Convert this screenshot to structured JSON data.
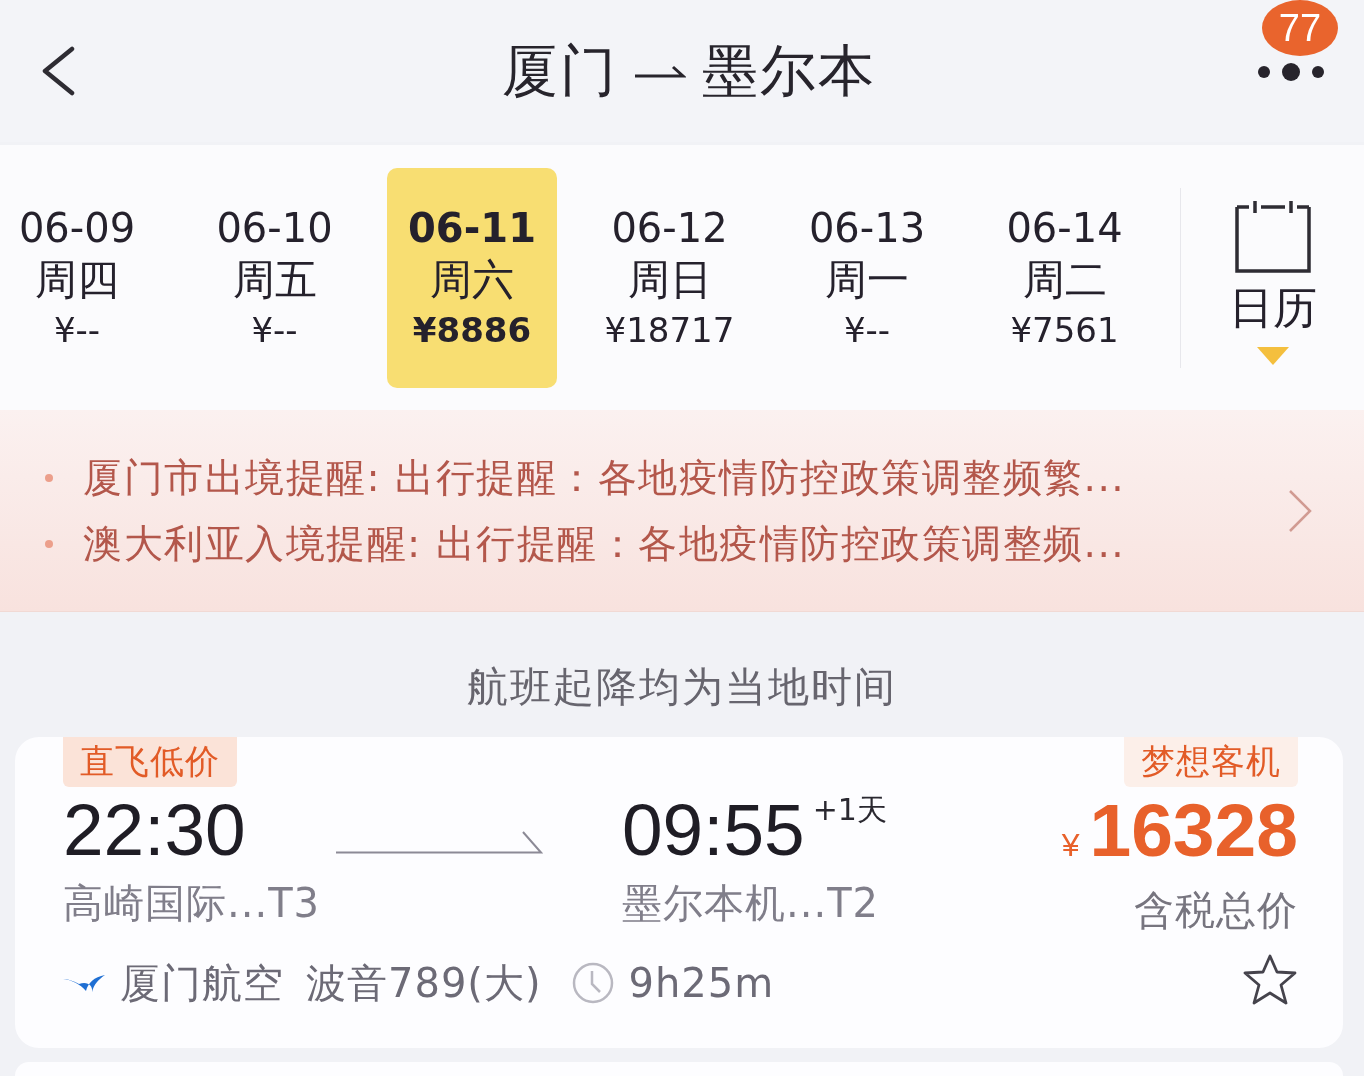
{
  "header": {
    "origin": "厦门",
    "destination": "墨尔本",
    "badge": "77"
  },
  "dates": [
    {
      "date": "06-09",
      "weekday": "周四",
      "price": "¥--",
      "selected": false
    },
    {
      "date": "06-10",
      "weekday": "周五",
      "price": "¥--",
      "selected": false
    },
    {
      "date": "06-11",
      "weekday": "周六",
      "price": "¥8886",
      "selected": true
    },
    {
      "date": "06-12",
      "weekday": "周日",
      "price": "¥18717",
      "selected": false
    },
    {
      "date": "06-13",
      "weekday": "周一",
      "price": "¥--",
      "selected": false
    },
    {
      "date": "06-14",
      "weekday": "周二",
      "price": "¥7561",
      "selected": false
    }
  ],
  "calendar": {
    "label": "日历"
  },
  "notices": [
    "厦门市出境提醒: 出行提醒：各地疫情防控政策调整频繁...",
    "澳大利亚入境提醒: 出行提醒：各地疫情防控政策调整频..."
  ],
  "note": "航班起降均为当地时间",
  "flights": [
    {
      "tag": "直飞低价",
      "aircraft_tag": "梦想客机",
      "departure": {
        "time": "22:30",
        "airport": "高崎国际...T3"
      },
      "arrival": {
        "time": "09:55",
        "day_offset": "+1天",
        "airport": "墨尔本机...T2"
      },
      "currency": "¥",
      "price": "16328",
      "price_note": "含税总价",
      "airline": "厦门航空",
      "aircraft": "波音789(大)",
      "duration": "9h25m",
      "favorited": false
    }
  ]
}
